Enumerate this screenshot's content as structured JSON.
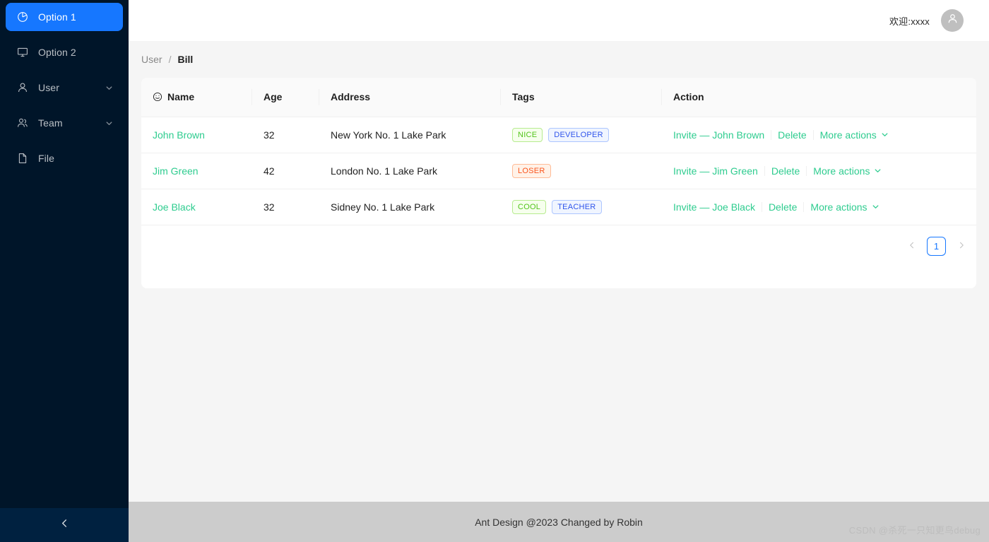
{
  "sidebar": {
    "items": [
      {
        "label": "Option 1",
        "icon": "pie-chart-icon",
        "selected": true,
        "arrow": false
      },
      {
        "label": "Option 2",
        "icon": "desktop-icon",
        "selected": false,
        "arrow": false
      },
      {
        "label": "User",
        "icon": "user-icon",
        "selected": false,
        "arrow": true
      },
      {
        "label": "Team",
        "icon": "team-icon",
        "selected": false,
        "arrow": true
      },
      {
        "label": "File",
        "icon": "file-icon",
        "selected": false,
        "arrow": false
      }
    ],
    "collapse_icon": "chevron-left-icon",
    "background_color": "#001529",
    "selected_color": "#1677ff"
  },
  "topbar": {
    "welcome_text": "欢迎:xxxx",
    "avatar_icon": "user-avatar-icon"
  },
  "breadcrumb": {
    "parent": "User",
    "separator": "/",
    "current": "Bill"
  },
  "table": {
    "columns": [
      {
        "key": "name",
        "label": "Name",
        "icon": "smiley-icon"
      },
      {
        "key": "age",
        "label": "Age",
        "icon": ""
      },
      {
        "key": "address",
        "label": "Address",
        "icon": ""
      },
      {
        "key": "tags",
        "label": "Tags",
        "icon": ""
      },
      {
        "key": "action",
        "label": "Action",
        "icon": ""
      }
    ],
    "rows": [
      {
        "name": "John Brown",
        "age": "32",
        "address": "New York No. 1 Lake Park",
        "tags": [
          {
            "text": "NICE",
            "color": "green"
          },
          {
            "text": "DEVELOPER",
            "color": "geekblue"
          }
        ],
        "actions": {
          "invite": "Invite — John Brown",
          "delete": "Delete",
          "more": "More actions"
        }
      },
      {
        "name": "Jim Green",
        "age": "42",
        "address": "London No. 1 Lake Park",
        "tags": [
          {
            "text": "LOSER",
            "color": "volcano"
          }
        ],
        "actions": {
          "invite": "Invite — Jim Green",
          "delete": "Delete",
          "more": "More actions"
        }
      },
      {
        "name": "Joe Black",
        "age": "32",
        "address": "Sidney No. 1 Lake Park",
        "tags": [
          {
            "text": "COOL",
            "color": "green"
          },
          {
            "text": "TEACHER",
            "color": "geekblue"
          }
        ],
        "actions": {
          "invite": "Invite — Joe Black",
          "delete": "Delete",
          "more": "More actions"
        }
      }
    ]
  },
  "pagination": {
    "prev_icon": "chevron-left-icon",
    "next_icon": "chevron-right-icon",
    "pages": [
      "1"
    ],
    "current": "1",
    "active_color": "#1677ff"
  },
  "footer": {
    "text": "Ant Design @2023 Changed by Robin",
    "watermark": "CSDN @杀死一只知更鸟debug"
  }
}
